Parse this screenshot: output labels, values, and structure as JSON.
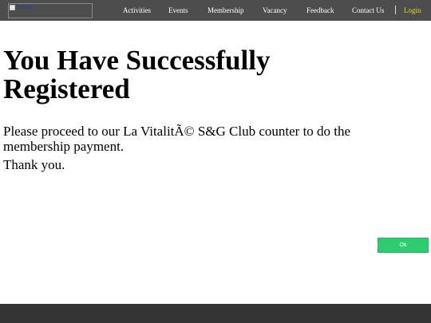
{
  "header": {
    "logo_alt": "Lavitalite",
    "logo_icon": "broken-image-icon",
    "nav": [
      {
        "label": "Activities"
      },
      {
        "label": "Events"
      },
      {
        "label": "Membership"
      },
      {
        "label": "Vacancy"
      },
      {
        "label": "Feedback"
      },
      {
        "label": "Contact Us"
      }
    ],
    "login_label": "Login"
  },
  "main": {
    "heading": "You Have Successfully Registered",
    "message": "Please proceed to our La VitalitÃ© S&G Club counter to do the membership payment.",
    "thanks": "Thank you.",
    "ok_label": "Ok"
  },
  "colors": {
    "nav_bg": "#4d4d4d",
    "login_accent": "#e8d62a",
    "button_green": "#2ecc71",
    "footer_bg": "#333333"
  }
}
